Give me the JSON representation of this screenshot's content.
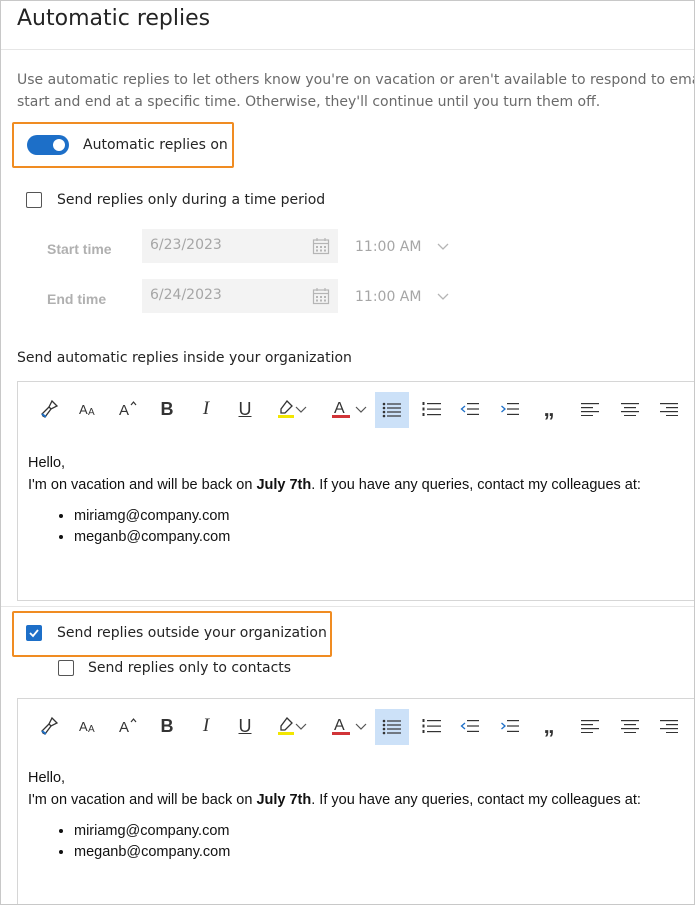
{
  "page": {
    "title": "Automatic replies",
    "description_line1": "Use automatic replies to let others know you're on vacation or aren't available to respond to email. You can set your replies to",
    "description_line2": "start and end at a specific time. Otherwise, they'll continue until you turn them off."
  },
  "toggle": {
    "label": "Automatic replies on",
    "on": true
  },
  "time_period": {
    "checkbox_label": "Send replies only during a time period",
    "checked": false,
    "start_label": "Start time",
    "start_date": "6/23/2023",
    "start_time": "11:00 AM",
    "end_label": "End time",
    "end_date": "6/24/2023",
    "end_time": "11:00 AM"
  },
  "inside": {
    "heading": "Send automatic replies inside your organization",
    "message": {
      "greeting": "Hello,",
      "line_before": "I'm on vacation and will be back on ",
      "bold": "July 7th",
      "line_after": ". If you have any queries, contact my colleagues at:",
      "contacts": [
        "miriamg@company.com",
        "meganb@company.com"
      ]
    }
  },
  "outside": {
    "checkbox_label": "Send replies outside your organization",
    "checked": true,
    "contacts_only_label": "Send replies only to contacts",
    "contacts_only_checked": false,
    "message": {
      "greeting": "Hello,",
      "line_before": "I'm on vacation and will be back on ",
      "bold": "July 7th",
      "line_after": ". If you have any queries, contact my colleagues at:",
      "contacts": [
        "miriamg@company.com",
        "meganb@company.com"
      ]
    }
  },
  "toolbar": {
    "bold_glyph": "B",
    "italic_glyph": "I",
    "underline_glyph": "U",
    "quote_glyph": "„",
    "highlight_color": "#f2e600",
    "font_color": "#d13438"
  },
  "colors": {
    "accent": "#1d6fc8",
    "highlight_border": "#f08c22"
  }
}
